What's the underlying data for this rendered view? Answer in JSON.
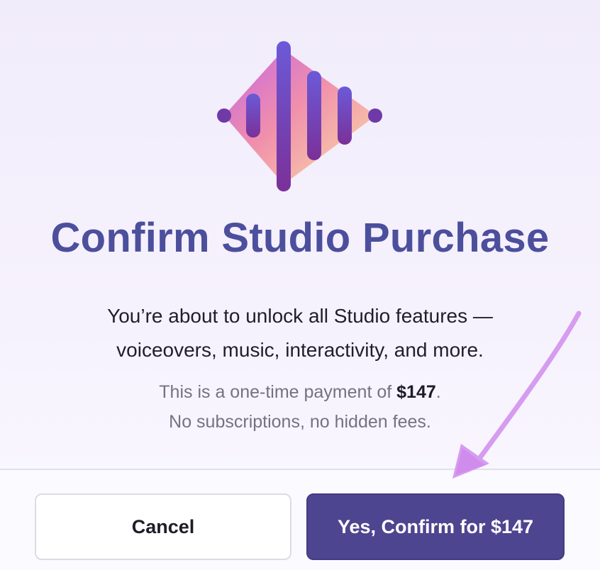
{
  "dialog": {
    "title": "Confirm Studio Purchase",
    "description_line1": "You’re about to unlock all Studio features —",
    "description_line2": "voiceovers, music, interactivity, and more.",
    "price_note_prefix": "This is a one-time payment of ",
    "price_amount": "$147",
    "price_note_suffix": ".",
    "price_note_line2": "No subscriptions, no hidden fees.",
    "logo_icon": "audio-waveform-icon",
    "annotation_icon": "arrow-pointer-icon"
  },
  "buttons": {
    "cancel_label": "Cancel",
    "confirm_label": "Yes, Confirm for $147"
  },
  "colors": {
    "title": "#4c4f9c",
    "confirm_button": "#4e4590",
    "logo_bars": "#6a3fb5",
    "annotation_arrow": "#d69cf0"
  }
}
